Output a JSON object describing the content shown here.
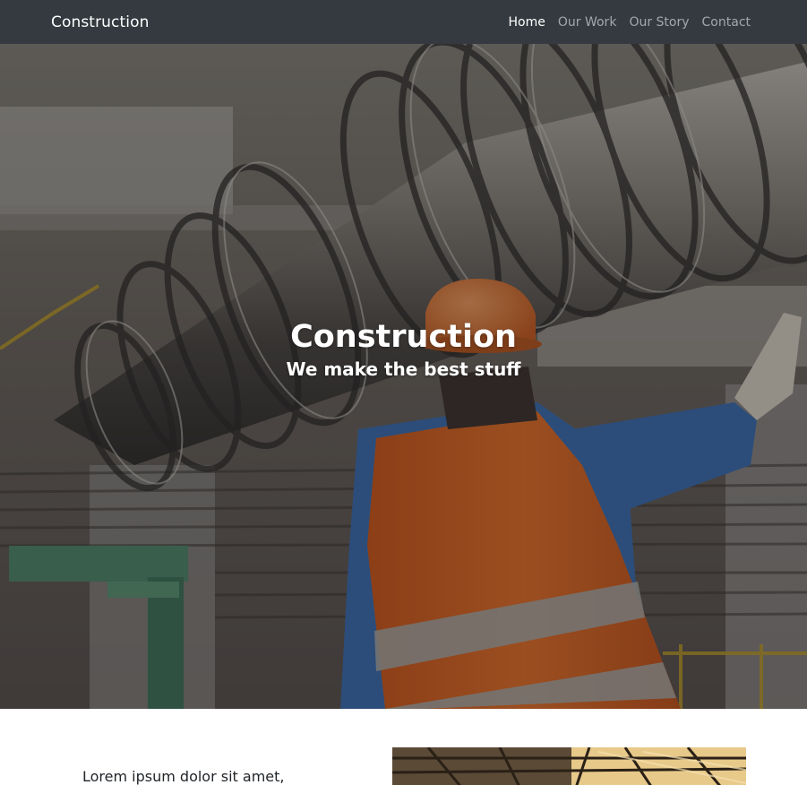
{
  "navbar": {
    "brand": "Construction",
    "links": [
      {
        "label": "Home",
        "active": true
      },
      {
        "label": "Our Work",
        "active": false
      },
      {
        "label": "Our Story",
        "active": false
      },
      {
        "label": "Contact",
        "active": false
      }
    ]
  },
  "hero": {
    "title": "Construction",
    "subtitle": "We make the best stuff",
    "image_subject": "worker in orange hard hat and hi-vis vest signaling a suspended turbine rotor in a factory"
  },
  "content": {
    "intro_text": "Lorem ipsum dolor sit amet,",
    "preview_image_subject": "industrial roof trusses"
  },
  "colors": {
    "navbar_bg": "#343a40",
    "nav_active": "#ffffff",
    "nav_inactive": "rgba(255,255,255,0.55)",
    "hardhat": "#e8752a",
    "vest": "#ef6a1f",
    "shirt": "#3a6fb4"
  }
}
